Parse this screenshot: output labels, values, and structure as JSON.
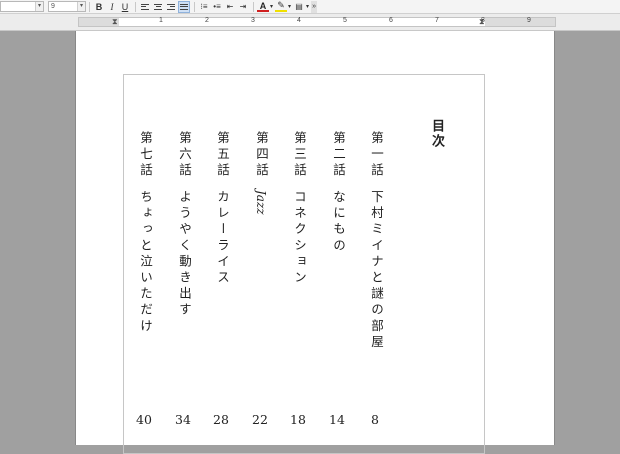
{
  "toolbar": {
    "font_name": "",
    "font_size": "9",
    "bold_label": "B",
    "italic_label": "I",
    "underline_label": "U"
  },
  "ruler": {
    "numbers": [
      "1",
      "2",
      "3",
      "4",
      "5",
      "6",
      "7",
      "8",
      "9"
    ]
  },
  "toc": {
    "title": "目次",
    "entries": [
      {
        "chapter": "第一話",
        "title": "下村ミイナと謎の部屋",
        "page": "8"
      },
      {
        "chapter": "第二話",
        "title": "なにもの",
        "page": "14"
      },
      {
        "chapter": "第三話",
        "title": "コネクション",
        "page": "18"
      },
      {
        "chapter": "第四話",
        "title": "Jazz",
        "page": "22"
      },
      {
        "chapter": "第五話",
        "title": "カレーライス",
        "page": "28"
      },
      {
        "chapter": "第六話",
        "title": "ようやく動き出す",
        "page": "34"
      },
      {
        "chapter": "第七話",
        "title": "ちょっと泣いただけ",
        "page": "40"
      }
    ]
  }
}
